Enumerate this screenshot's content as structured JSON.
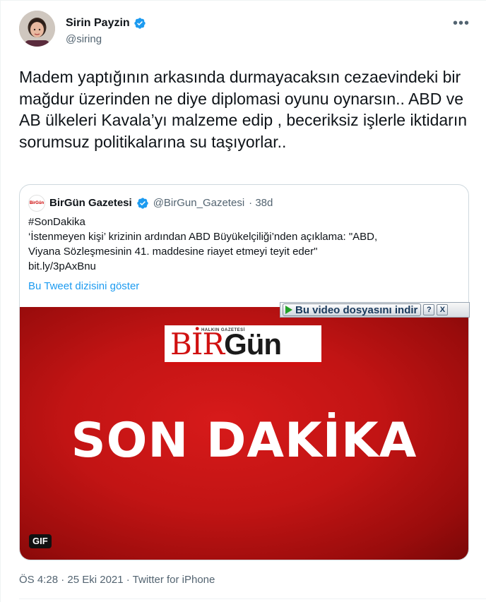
{
  "tweet": {
    "author_name": "Sirin Payzin",
    "author_handle": "@siring",
    "more_label": "•••",
    "text": "Madem yaptığının arkasında durmayacaksın cezaevindeki bir mağdur üzerinden ne diye diplomasi oyunu oynarsın.. ABD ve AB ülkeleri Kavala’yı malzeme edip , beceriksiz işlerle iktidarın sorumsuz politikalarına su taşıyorlar..",
    "timestamp": "ÖS 4:28 · 25 Eki 2021 · Twitter for iPhone"
  },
  "quote": {
    "logo_text": "BirGün",
    "author_name": "BirGün Gazetesi",
    "author_handle": "@BirGun_Gazetesi",
    "age": "· 38d",
    "lines": [
      "#SonDakika",
      "‘İstenmeyen kişi’ krizinin ardından ABD Büyükelçiliği’nden açıklama: \"ABD,",
      "Viyana Sözleşmesinin 41. maddesine riayet etmeyi teyit eder\"",
      "bit.ly/3pAxBnu"
    ],
    "show_thread": "Bu Tweet dizisini göster"
  },
  "media": {
    "logo_small": "HALKIN GAZETESİ",
    "logo_bir": "BİR",
    "logo_gun": "Gün",
    "headline": "SON DAKİKA",
    "gif_badge": "GIF"
  },
  "download_bar": {
    "label": "Bu video dosyasını indir",
    "help": "?",
    "close": "X"
  },
  "colors": {
    "link": "#1d9bf0",
    "verified": "#1d9bf0",
    "media_red": "#c21414"
  }
}
